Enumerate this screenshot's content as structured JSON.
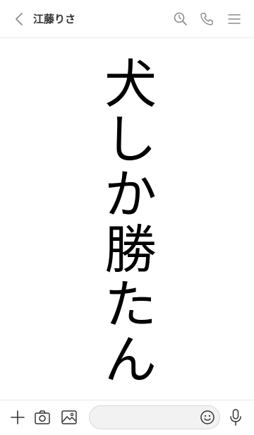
{
  "header": {
    "title": "江藤りさ",
    "icons": {
      "back": "chevron-left-icon",
      "search": "search-clock-icon",
      "call": "phone-icon",
      "menu": "hamburger-menu-icon"
    }
  },
  "message": {
    "chars": [
      "犬",
      "し",
      "か",
      "勝",
      "た",
      "ん"
    ]
  },
  "footer": {
    "input_placeholder": "",
    "icons": {
      "plus": "plus-icon",
      "camera": "camera-icon",
      "image": "image-icon",
      "emoji": "emoji-icon",
      "mic": "microphone-icon"
    }
  },
  "colors": {
    "icon": "#8c8c8c",
    "text": "#000000",
    "title": "#333333",
    "input_bg": "#f2f2f2"
  }
}
